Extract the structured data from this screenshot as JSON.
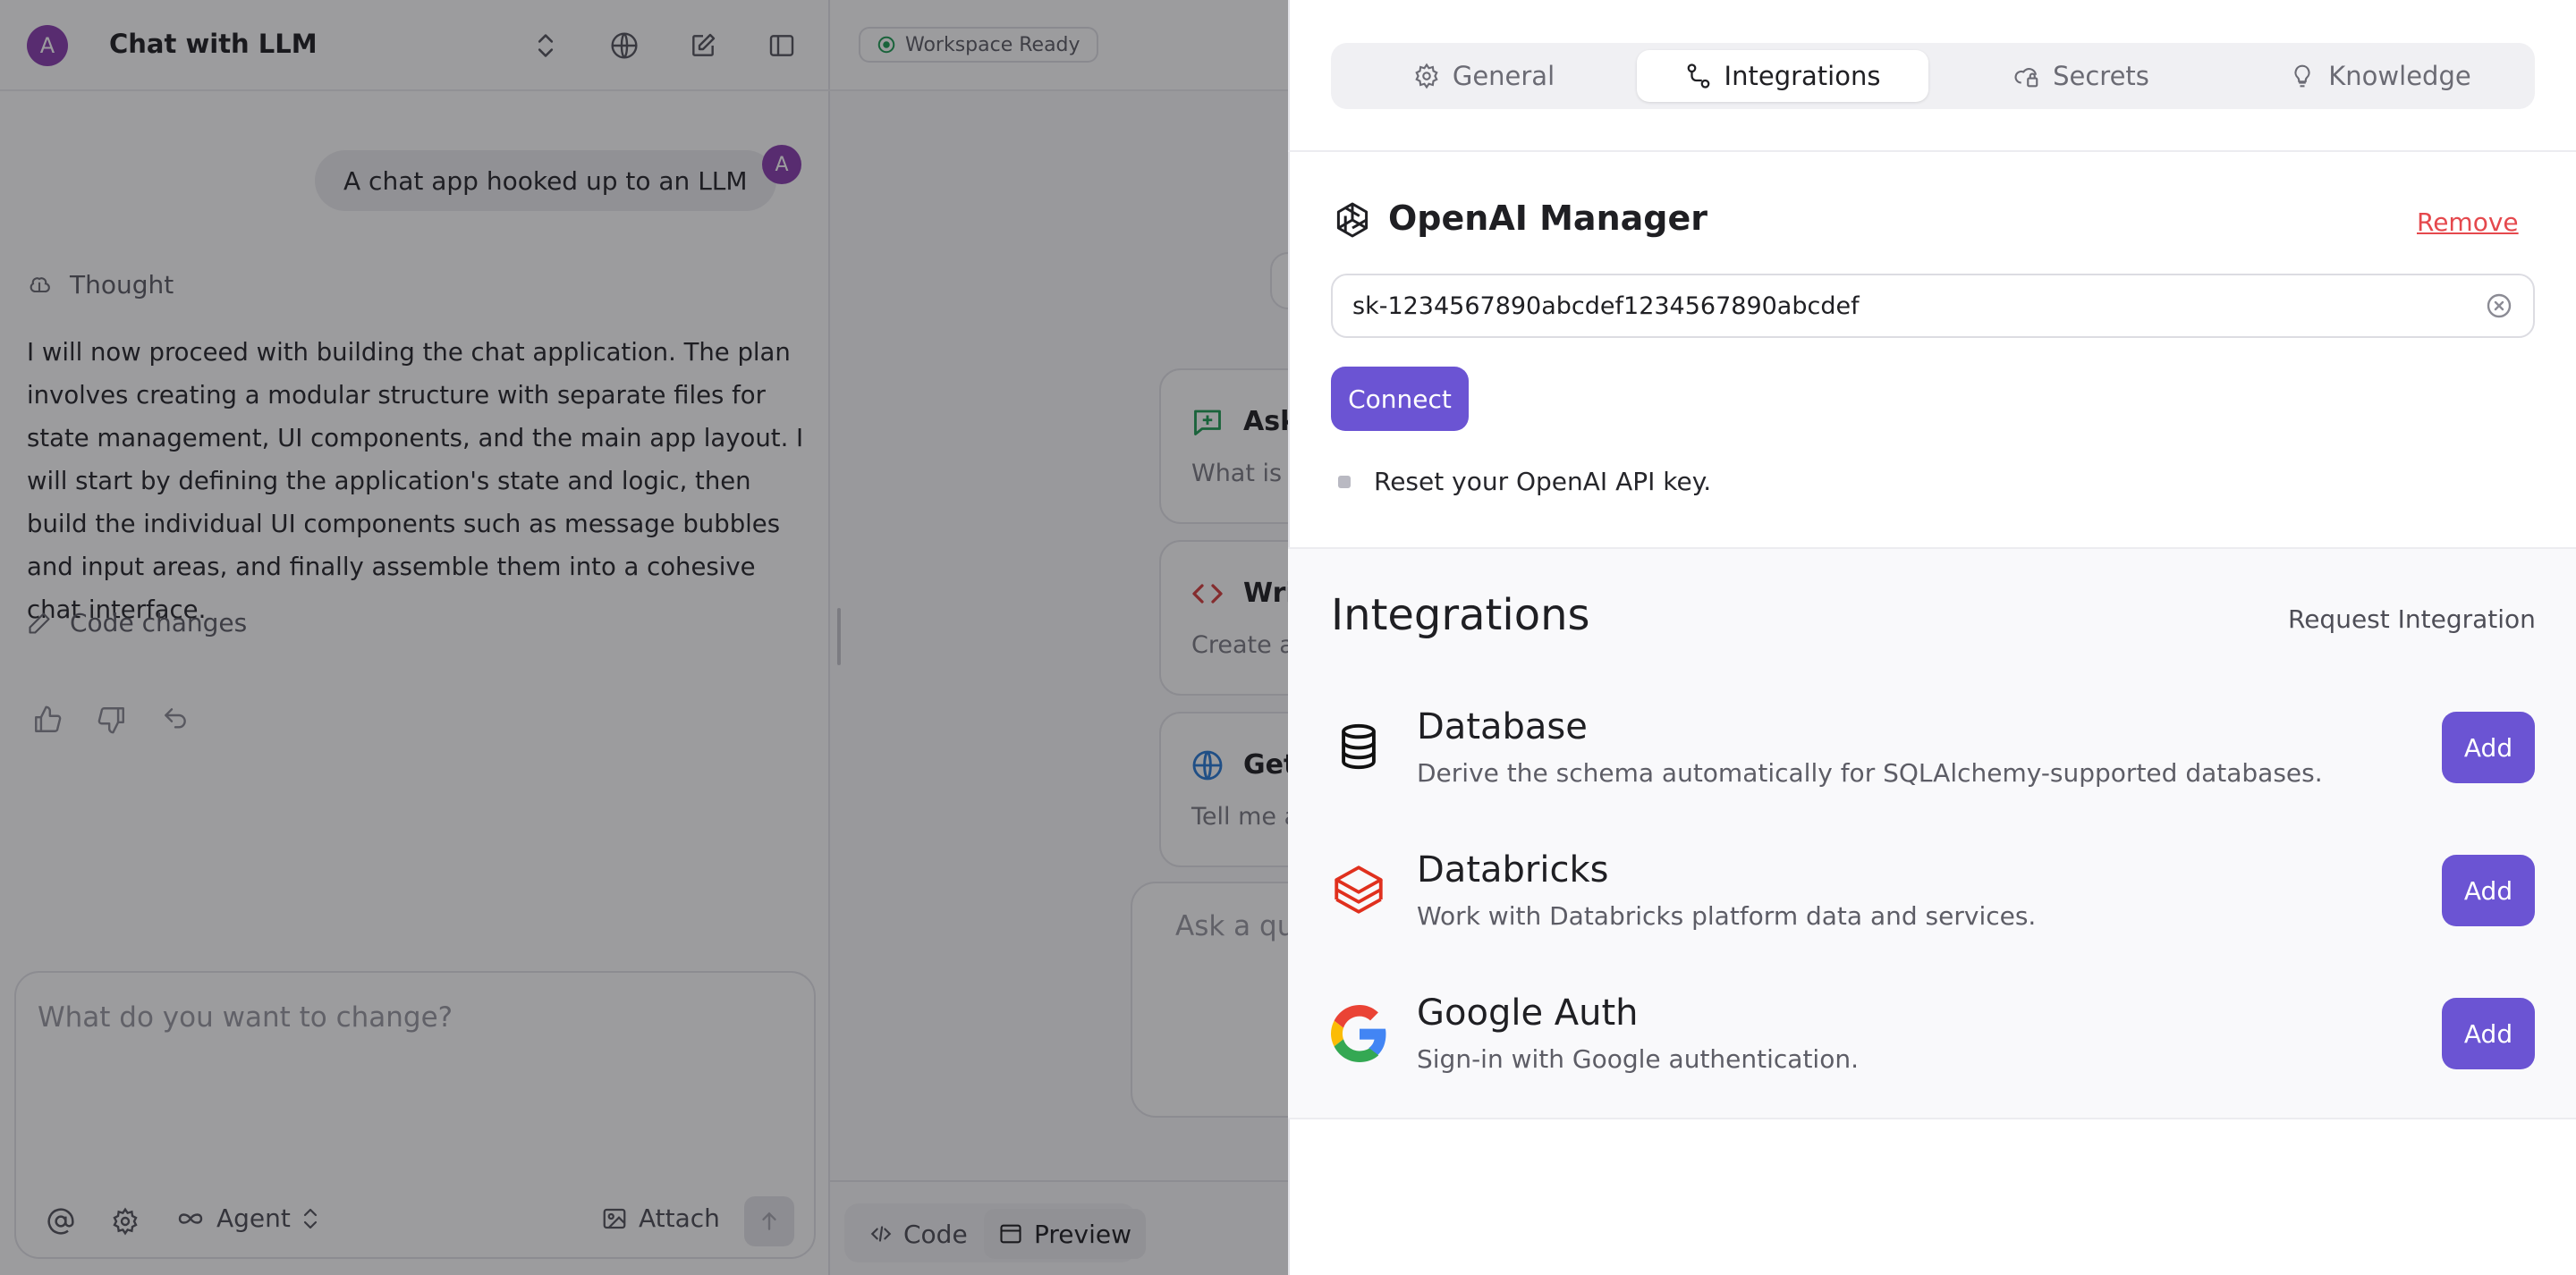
{
  "chat": {
    "avatar_letter": "A",
    "title": "Chat with LLM",
    "user_message": "A chat app hooked up to an LLM",
    "thought_label": "Thought",
    "thought_text": "I will now proceed with building the chat application. The plan involves creating a modular structure with separate files for state management, UI components, and the main app layout. I will start by defining the application's state and logic, then build the individual UI components such as message bubbles and input areas, and finally assemble them into a cohesive chat interface.",
    "code_changes_label": "Code changes",
    "composer_placeholder": "What do you want to change?",
    "agent_label": "Agent",
    "attach_label": "Attach"
  },
  "workspace": {
    "status": "Workspace Ready",
    "cards": [
      {
        "title": "Ask",
        "subtitle": "What is"
      },
      {
        "title": "Wri",
        "subtitle": "Create a"
      },
      {
        "title": "Get",
        "subtitle": "Tell me a"
      }
    ],
    "ask_placeholder": "Ask a qu",
    "code_tab": "Code",
    "preview_tab": "Preview"
  },
  "settings": {
    "tabs": [
      "General",
      "Integrations",
      "Secrets",
      "Knowledge"
    ],
    "active_tab": "Integrations",
    "manager": {
      "title": "OpenAI Manager",
      "remove_label": "Remove",
      "api_key_value": "sk-1234567890abcdef1234567890abcdef",
      "connect_label": "Connect",
      "note": "Reset your OpenAI API key."
    },
    "integrations": {
      "heading": "Integrations",
      "request_label": "Request Integration",
      "items": [
        {
          "name": "Database",
          "description": "Derive the schema automatically for SQLAlchemy-supported databases.",
          "button": "Add",
          "icon": "database-icon"
        },
        {
          "name": "Databricks",
          "description": "Work with Databricks platform data and services.",
          "button": "Add",
          "icon": "databricks-icon"
        },
        {
          "name": "Google Auth",
          "description": "Sign-in with Google authentication.",
          "button": "Add",
          "icon": "google-icon"
        }
      ]
    }
  },
  "colors": {
    "accent": "#6b54d3",
    "avatar": "#8a3fb0",
    "danger": "#e5484d",
    "ready_green": "#1f9d55"
  }
}
